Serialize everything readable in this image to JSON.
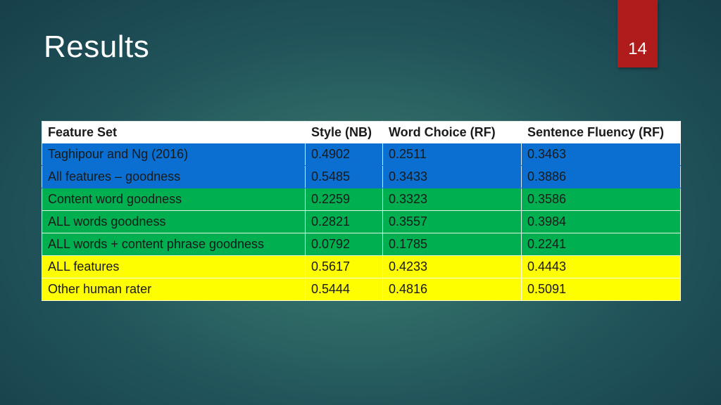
{
  "slide": {
    "title": "Results",
    "page_number": "14"
  },
  "table": {
    "headers": [
      "Feature Set",
      "Style (NB)",
      "Word Choice (RF)",
      "Sentence Fluency (RF)"
    ],
    "rows": [
      {
        "label": "Taghipour and Ng (2016)",
        "style": "0.4902",
        "word_choice": "0.2511",
        "sentence_fluency": "0.3463",
        "color": "#0a6fd0"
      },
      {
        "label": "All features – goodness",
        "style": "0.5485",
        "word_choice": "0.3433",
        "sentence_fluency": "0.3886",
        "color": "#0a6fd0"
      },
      {
        "label": "Content word goodness",
        "style": "0.2259",
        "word_choice": "0.3323",
        "sentence_fluency": "0.3586",
        "color": "#00b050"
      },
      {
        "label": "ALL words goodness",
        "style": "0.2821",
        "word_choice": "0.3557",
        "sentence_fluency": "0.3984",
        "color": "#00b050"
      },
      {
        "label": "ALL words + content phrase goodness",
        "style": "0.0792",
        "word_choice": "0.1785",
        "sentence_fluency": "0.2241",
        "color": "#00b050"
      },
      {
        "label": "ALL features",
        "style": "0.5617",
        "word_choice": "0.4233",
        "sentence_fluency": "0.4443",
        "color": "#fffe00"
      },
      {
        "label": "Other human rater",
        "style": "0.5444",
        "word_choice": "0.4816",
        "sentence_fluency": "0.5091",
        "color": "#fffe00"
      }
    ]
  },
  "colors": {
    "header_bg": "#ffffff",
    "page_tab": "#b01c1c"
  }
}
